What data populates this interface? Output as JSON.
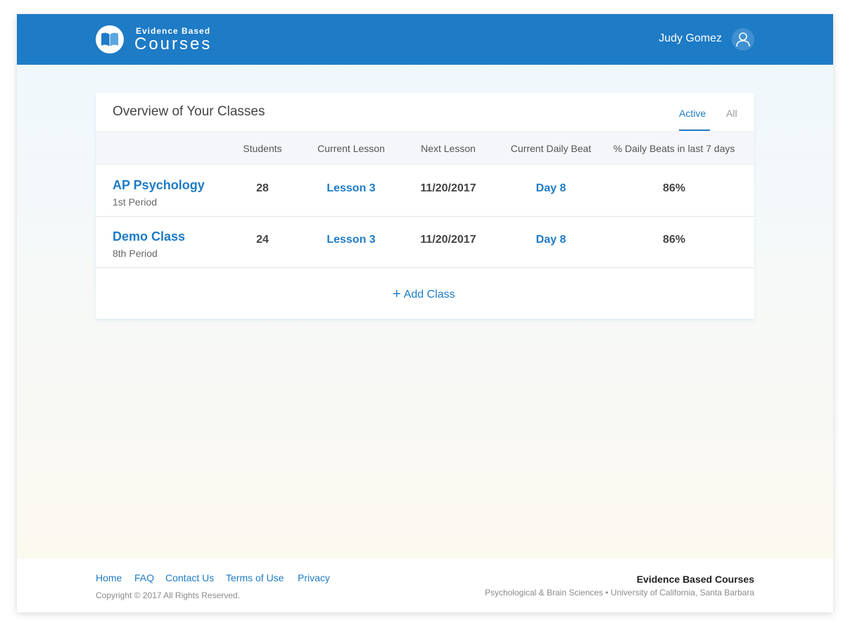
{
  "header": {
    "brand_small": "Evidence Based",
    "brand_big": "Courses",
    "user_name": "Judy Gomez"
  },
  "overview": {
    "title": "Overview of Your Classes",
    "tabs": [
      {
        "label": "Active",
        "selected": true
      },
      {
        "label": "All",
        "selected": false
      }
    ],
    "columns": [
      "Students",
      "Current Lesson",
      "Next Lesson",
      "Current Daily Beat",
      "% Daily Beats in last 7 days"
    ],
    "rows": [
      {
        "name": "AP Psychology",
        "period": "1st Period",
        "students": "28",
        "current_lesson": "Lesson 3",
        "next_lesson": "11/20/2017",
        "daily_beat": "Day 8",
        "percent": "86%"
      },
      {
        "name": "Demo Class",
        "period": "8th Period",
        "students": "24",
        "current_lesson": "Lesson 3",
        "next_lesson": "11/20/2017",
        "daily_beat": "Day 8",
        "percent": "86%"
      }
    ],
    "add_class_label": "Add Class"
  },
  "footer": {
    "links": [
      "Home",
      "FAQ",
      "Contact Us",
      "Terms of Use",
      "Privacy"
    ],
    "copyright": "Copyright © 2017 All Rights Reserved.",
    "brand": "Evidence Based Courses",
    "sub": "Psychological & Brain Sciences • University of California, Santa Barbara"
  },
  "colors": {
    "primary": "#1e7bc5",
    "header_bg": "#1e7bc5",
    "table_header_bg": "#f4f6f9"
  },
  "icons": {
    "logo": "book-icon",
    "avatar": "user-icon",
    "add": "plus-icon"
  }
}
